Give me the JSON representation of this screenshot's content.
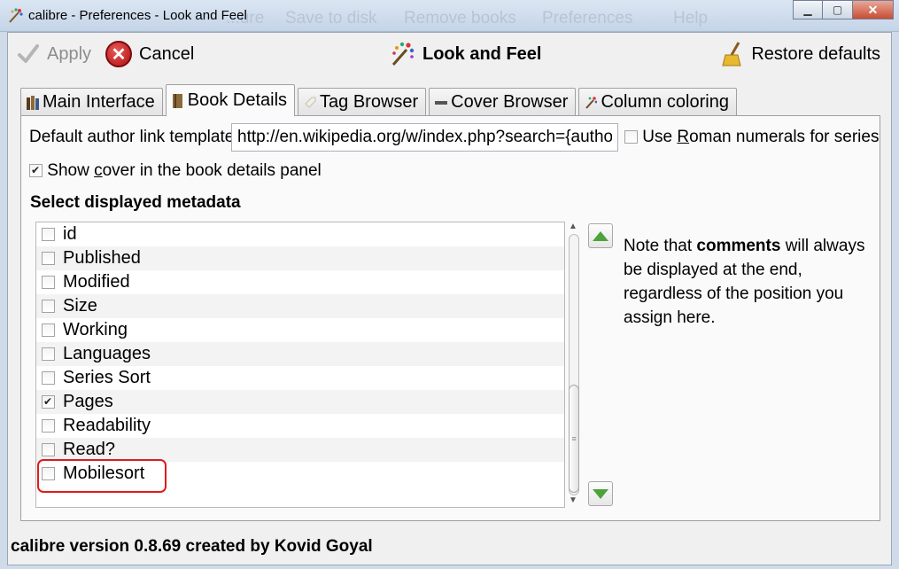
{
  "window": {
    "title": "calibre - Preferences - Look and Feel",
    "background_ghost_items": [
      "...ure",
      "Save to disk",
      "Remove books",
      "Preferences",
      "Help"
    ],
    "controls": [
      "minimize",
      "maximize",
      "close"
    ]
  },
  "toolbar": {
    "apply_label": "Apply",
    "apply_enabled": false,
    "cancel_label": "Cancel",
    "page_title": "Look and Feel",
    "restore_label": "Restore defaults"
  },
  "tabs": [
    {
      "label": "Main Interface",
      "icon": "books-icon",
      "active": false
    },
    {
      "label": "Book Details",
      "icon": "book-icon",
      "active": true
    },
    {
      "label": "Tag Browser",
      "icon": "tag-icon",
      "active": false
    },
    {
      "label": "Cover Browser",
      "icon": "cover-icon",
      "active": false
    },
    {
      "label": "Column coloring",
      "icon": "palette-icon",
      "active": false
    }
  ],
  "book_details": {
    "author_link_label": "Default author link template:",
    "author_link_value": "http://en.wikipedia.org/w/index.php?search={author}",
    "roman_numerals_label_pre": "Use ",
    "roman_numerals_label_ul": "R",
    "roman_numerals_label_post": "oman numerals for series",
    "roman_numerals_checked": false,
    "show_cover_label_pre": "Show ",
    "show_cover_label_ul": "c",
    "show_cover_label_post": "over in the book details panel",
    "show_cover_checked": true,
    "section_title": "Select displayed metadata",
    "metadata": [
      {
        "label": "id",
        "checked": false
      },
      {
        "label": "Published",
        "checked": false
      },
      {
        "label": "Modified",
        "checked": false
      },
      {
        "label": "Size",
        "checked": false
      },
      {
        "label": "Working",
        "checked": false
      },
      {
        "label": "Languages",
        "checked": false
      },
      {
        "label": "Series Sort",
        "checked": false
      },
      {
        "label": "Pages",
        "checked": true
      },
      {
        "label": "Readability",
        "checked": false
      },
      {
        "label": "Read?",
        "checked": false
      },
      {
        "label": "Mobilesort",
        "checked": false
      }
    ],
    "note_pre": "Note that ",
    "note_bold": "comments",
    "note_post": " will always be displayed at the end, regardless of the position you assign here."
  },
  "footer": {
    "version_text": "calibre version 0.8.69 created by Kovid Goyal"
  },
  "colors": {
    "highlight": "#e01b1b",
    "move_arrow": "#4ca33a"
  }
}
